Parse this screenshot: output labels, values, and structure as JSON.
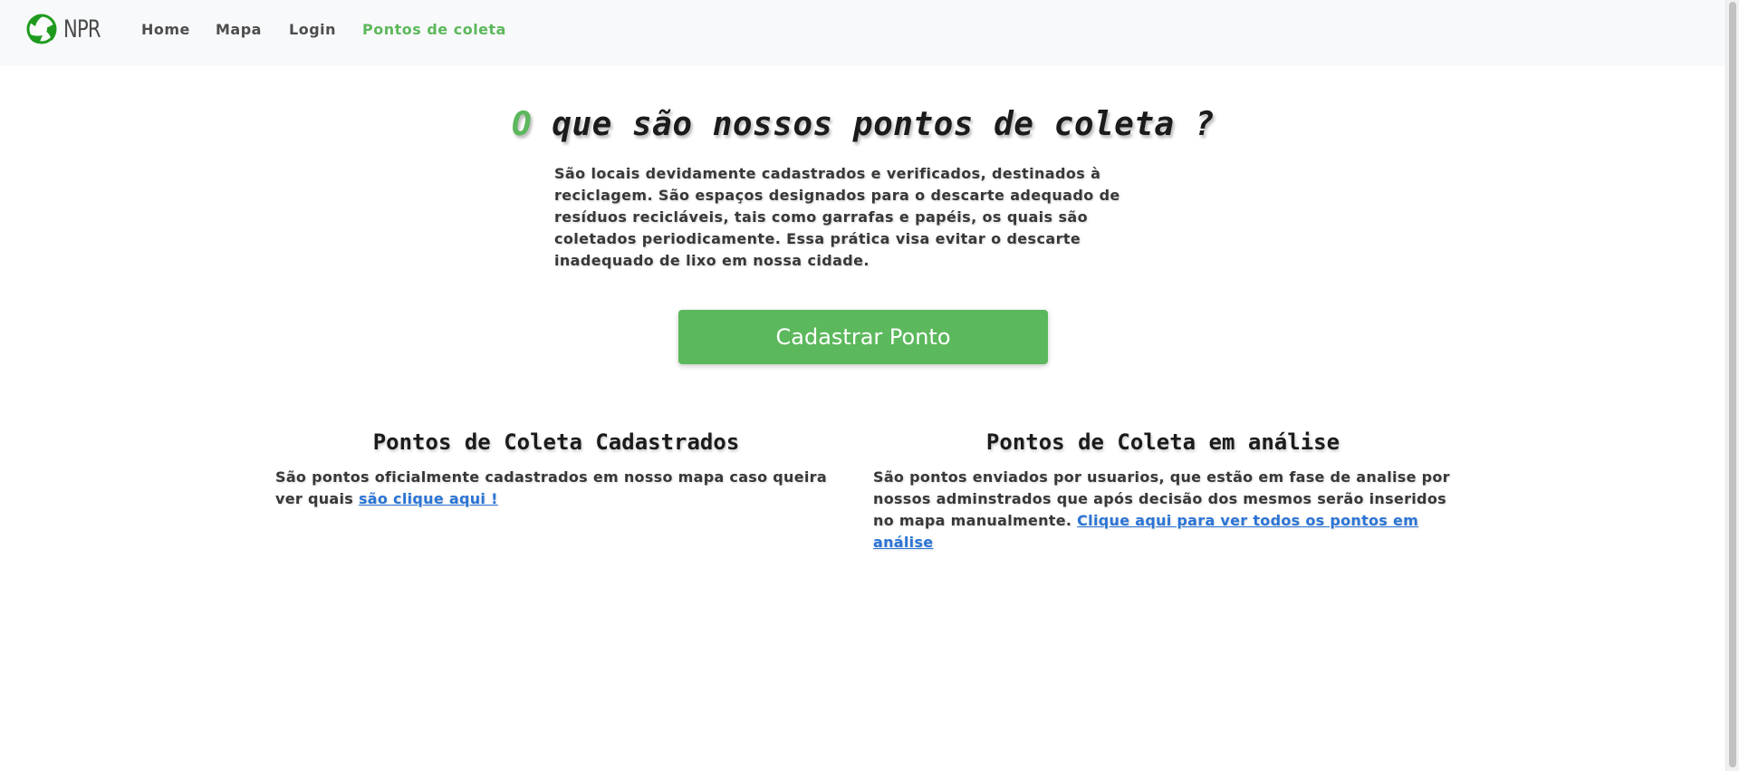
{
  "navbar": {
    "brand_text": "NPR",
    "links": [
      {
        "label": "Home"
      },
      {
        "label": "Mapa"
      },
      {
        "label": "Login"
      },
      {
        "label": "Pontos de coleta",
        "active": true
      }
    ]
  },
  "hero": {
    "title_accent": "O",
    "title_rest": " que são nossos pontos de coleta ?",
    "description": "São locais devidamente cadastrados e verificados, destinados à reciclagem. São espaços designados para o descarte adequado de resíduos recicláveis, tais como garrafas e papéis, os quais são coletados periodicamente. Essa prática visa evitar o descarte inadequado de lixo em nossa cidade.",
    "button_label": "Cadastrar Ponto"
  },
  "sections": [
    {
      "title": "Pontos de Coleta Cadastrados",
      "text": "São pontos oficialmente cadastrados em nosso mapa caso queira ver quais ",
      "link": "são clique aqui !"
    },
    {
      "title": "Pontos de Coleta em análise",
      "text": "São pontos enviados por usuarios, que estão em fase de analise por nossos adminstrados que após decisão dos mesmos serão inseridos no mapa manualmente. ",
      "link": "Clique aqui para ver todos os pontos em análise"
    }
  ],
  "colors": {
    "accent": "#5cb85c",
    "link": "#2a74d6",
    "navbar_bg": "#f8f9fa"
  },
  "icons": {
    "brand_logo": "recycle-logo-icon"
  }
}
